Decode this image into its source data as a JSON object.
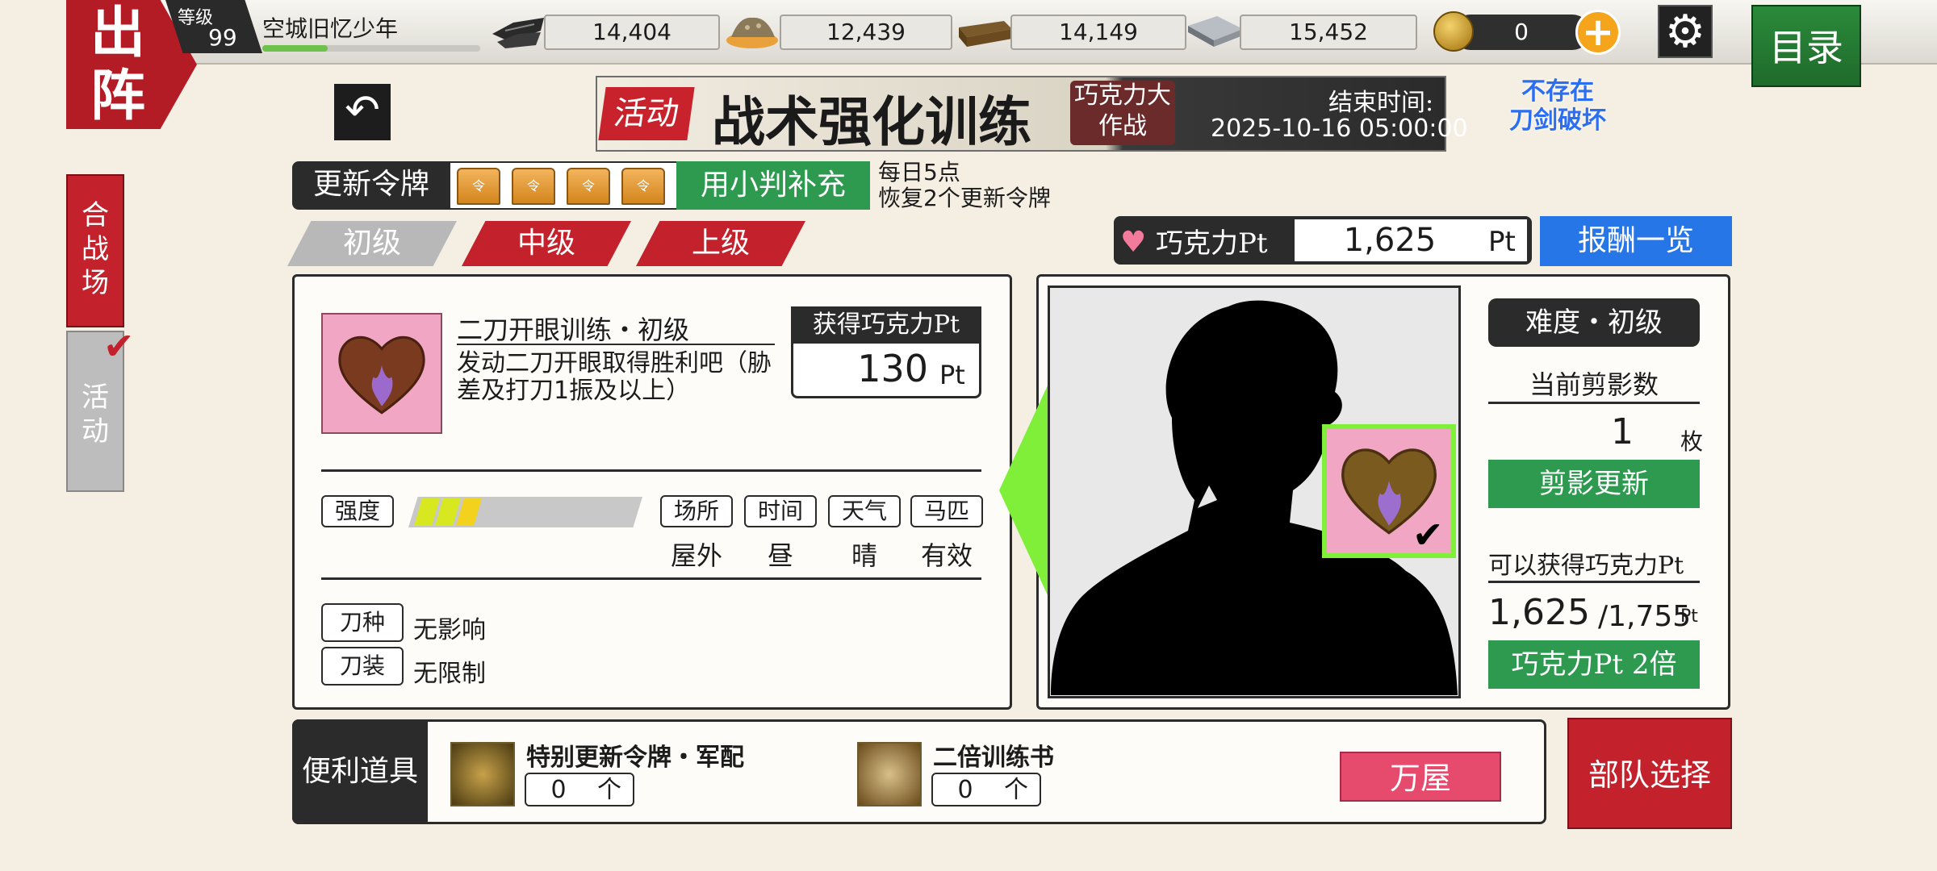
{
  "header": {
    "sortie_label": "出阵",
    "level_label": "等级",
    "level": "99",
    "player_name": "空城旧忆少年",
    "exp_progress": 0.3,
    "resources": [
      {
        "icon": "charcoal-icon",
        "value": "14,404"
      },
      {
        "icon": "whetstone-icon",
        "value": "12,439"
      },
      {
        "icon": "cooling-material-icon",
        "value": "14,149"
      },
      {
        "icon": "steel-icon",
        "value": "15,452"
      }
    ],
    "coins": "0",
    "menu_label": "目录"
  },
  "sidebar": {
    "tabs": [
      {
        "label": "合\n战\n场"
      },
      {
        "label": "活\n动"
      }
    ]
  },
  "banner": {
    "tag": "活动",
    "title": "战术强化训练",
    "subtitle": "巧克力大作战",
    "end_label": "结束时间:",
    "end_time": "2025-10-16 05:00:00",
    "stamp": "不存在\n刀剑破坏"
  },
  "tokens": {
    "label": "更新令牌",
    "count": 4,
    "refill_label": "用小判补充",
    "note_line1": "每日5点",
    "note_line2": "恢复2个更新令牌"
  },
  "difficulty_tabs": [
    {
      "label": "初级",
      "state": "selected"
    },
    {
      "label": "中级",
      "state": "normal"
    },
    {
      "label": "上级",
      "state": "normal"
    }
  ],
  "points": {
    "label": "巧克力Pt",
    "value": "1,625",
    "unit": "Pt",
    "reward_label": "报酬一览"
  },
  "mission": {
    "title": "二刀开眼训练・初级",
    "description": "发动二刀开眼取得胜利吧（胁差及打刀1振及以上）",
    "gain_label": "获得巧克力Pt",
    "gain_value": "130",
    "gain_unit": "Pt",
    "intensity_label": "强度",
    "intensity_level": 3,
    "conditions": [
      {
        "label": "场所",
        "value": "屋外"
      },
      {
        "label": "时间",
        "value": "昼"
      },
      {
        "label": "天气",
        "value": "晴"
      },
      {
        "label": "马匹",
        "value": "有效"
      }
    ],
    "sword_type_label": "刀种",
    "sword_type_value": "无影响",
    "equipment_label": "刀装",
    "equipment_value": "无限制"
  },
  "target": {
    "difficulty": "难度・初级",
    "current_label": "当前剪影数",
    "current_value": "1",
    "current_unit": "枚",
    "refresh_label": "剪影更新",
    "available_label": "可以获得巧克力Pt",
    "available_value": "1,625",
    "available_max": "/1,755",
    "available_unit": "Pt",
    "double_label": "巧克力Pt 2倍"
  },
  "tools": {
    "label": "便利道具",
    "items": [
      {
        "name": "特别更新令牌・军配",
        "count": "0",
        "unit": "个"
      },
      {
        "name": "二倍训练书",
        "count": "0",
        "unit": "个"
      }
    ],
    "shop_label": "万屋"
  },
  "deploy_label": "部队选择"
}
